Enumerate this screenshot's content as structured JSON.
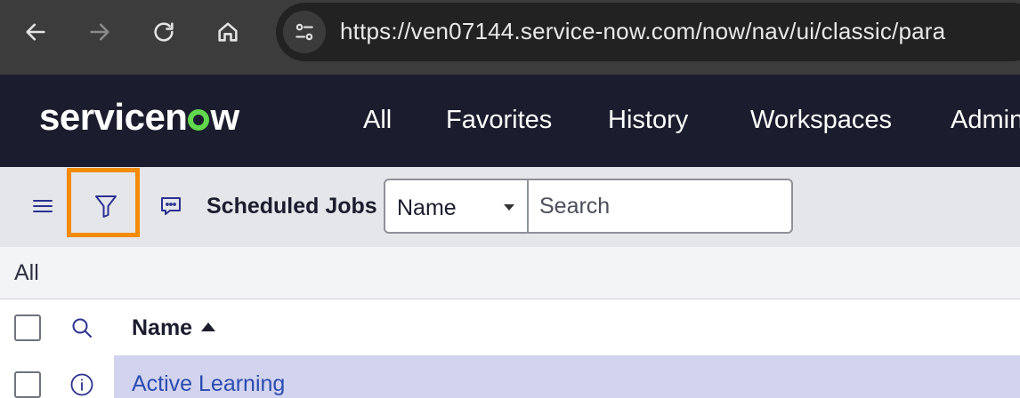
{
  "browser": {
    "url": "https://ven07144.service-now.com/now/nav/ui/classic/para",
    "icons": [
      "back-arrow-icon",
      "forward-arrow-icon",
      "reload-icon",
      "home-icon",
      "site-info-icon"
    ]
  },
  "header": {
    "logo_text_left": "servicen",
    "logo_text_right": "w",
    "nav": [
      "All",
      "Favorites",
      "History",
      "Workspaces",
      "Admin"
    ]
  },
  "toolbar": {
    "title": "Scheduled Jobs",
    "field_select": "Name",
    "search_placeholder": "Search",
    "icons": [
      "hamburger-menu-icon",
      "filter-icon",
      "chat-bubble-icon"
    ]
  },
  "breadcrumb": "All",
  "table": {
    "columns": [
      "Name"
    ],
    "sort": "ascending",
    "rows": [
      {
        "name": "Active Learning"
      }
    ]
  },
  "colors": {
    "header_bg": "#1b1d2e",
    "accent_green": "#62d84e",
    "highlight_orange": "#f58a07",
    "row_highlight": "#d2d3ef",
    "link_blue": "#2b4bb0"
  }
}
